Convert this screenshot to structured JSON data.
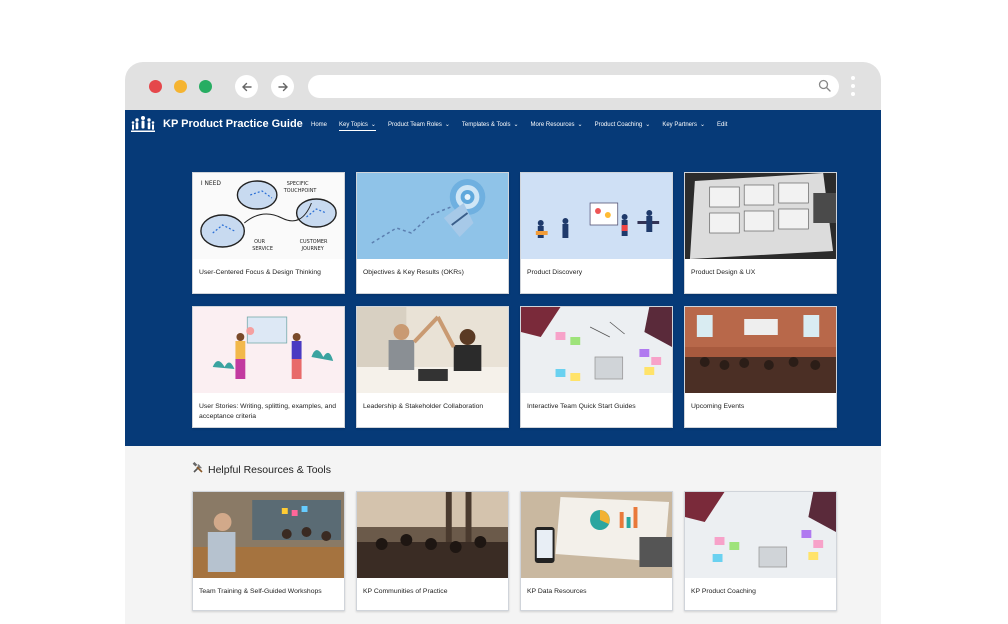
{
  "site": {
    "title": "KP Product Practice Guide",
    "brand_color": "#063a78"
  },
  "nav": {
    "items": [
      {
        "label": "Home",
        "has_dropdown": false,
        "active": false
      },
      {
        "label": "Key Topics",
        "has_dropdown": true,
        "active": true
      },
      {
        "label": "Product Team Roles",
        "has_dropdown": true,
        "active": false
      },
      {
        "label": "Templates & Tools",
        "has_dropdown": true,
        "active": false
      },
      {
        "label": "More Resources",
        "has_dropdown": true,
        "active": false
      },
      {
        "label": "Product Coaching",
        "has_dropdown": true,
        "active": false
      },
      {
        "label": "Key Partners",
        "has_dropdown": true,
        "active": false
      },
      {
        "label": "Edit",
        "has_dropdown": false,
        "active": false
      }
    ]
  },
  "key_topics": [
    {
      "label": "User-Centered Focus & Design Thinking",
      "image": "sketch-diagram"
    },
    {
      "label": "Objectives & Key Results (OKRs)",
      "image": "target-illustration"
    },
    {
      "label": "Product Discovery",
      "image": "team-illustration"
    },
    {
      "label": "Product Design & UX",
      "image": "wireframe-photo"
    },
    {
      "label": "User Stories: Writing, splitting, examples, and acceptance criteria",
      "image": "whiteboard-illustration"
    },
    {
      "label": "Leadership & Stakeholder Collaboration",
      "image": "high-five-photo"
    },
    {
      "label": "Interactive Team Quick Start Guides",
      "image": "sticky-notes-photo"
    },
    {
      "label": "Upcoming Events",
      "image": "event-photo"
    }
  ],
  "resources_section": {
    "icon": "tools-icon",
    "title": "Helpful Resources & Tools"
  },
  "resources": [
    {
      "label": "Team Training & Self-Guided Workshops",
      "image": "workshop-photo"
    },
    {
      "label": "KP Communities of Practice",
      "image": "community-photo"
    },
    {
      "label": "KP Data Resources",
      "image": "data-photo"
    },
    {
      "label": "KP Product Coaching",
      "image": "coaching-photo"
    }
  ]
}
